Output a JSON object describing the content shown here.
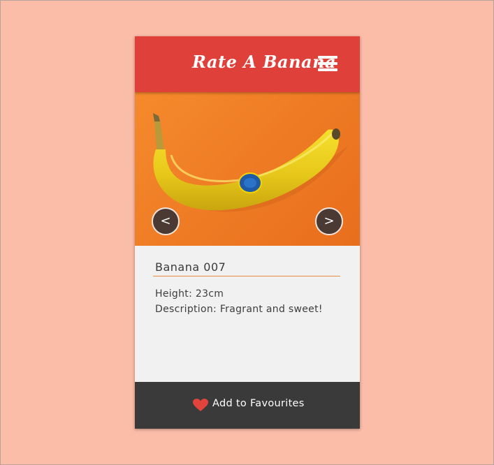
{
  "app": {
    "title": "Rate A Banana",
    "menu_icon": "hamburger-menu-icon",
    "header_color": "#e0403a"
  },
  "carousel": {
    "prev_label": "<",
    "next_label": ">",
    "background_color": "#f07d27"
  },
  "item": {
    "name": "Banana 007",
    "height_label": "Height:",
    "height_value": "23cm",
    "description_label": "Description:",
    "description_value": "Fragrant and sweet!"
  },
  "footer": {
    "favourite_label": "Add to Favourites",
    "heart_icon": "heart-icon",
    "heart_color": "#e0443c",
    "background": "#3a3a3a"
  }
}
